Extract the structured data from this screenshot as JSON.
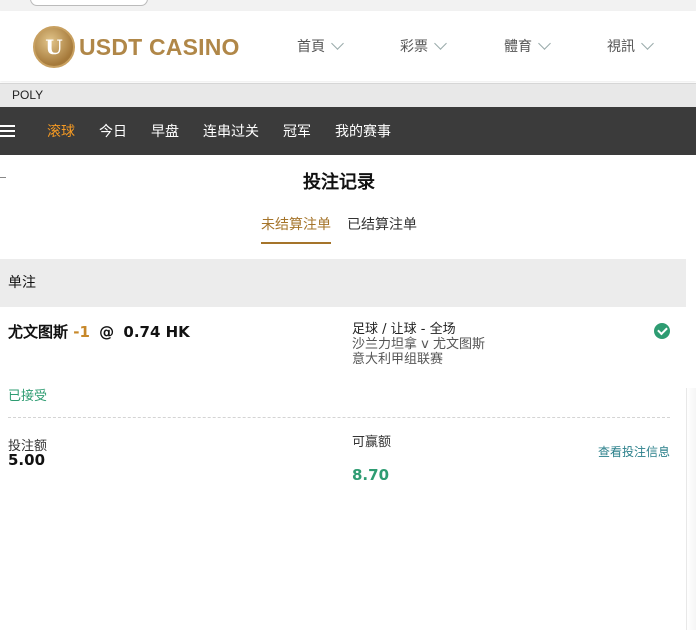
{
  "header": {
    "logo_letter": "U",
    "logo_text": "USDT CASINO",
    "nav": [
      "首頁",
      "彩票",
      "體育",
      "視訊"
    ]
  },
  "provider": "POLY",
  "sport_tabs": [
    "滚球",
    "今日",
    "早盘",
    "连串过关",
    "冠军",
    "我的赛事"
  ],
  "active_tab": "滚球",
  "page_title": "投注记录",
  "subtabs": [
    "未结算注单",
    "已结算注单"
  ],
  "section_label": "单注",
  "bet": {
    "selection": "尤文图斯",
    "handicap": "-1",
    "at": "@",
    "odds": "0.74 HK",
    "market": "足球 / 让球 - 全场",
    "teams": "沙兰力坦拿 v 尤文图斯",
    "league": "意大利甲组联赛",
    "status": "已接受",
    "stake_label": "投注额",
    "stake": "5.00",
    "win_label": "可赢额",
    "win": "8.70",
    "view_link": "查看投注信息"
  },
  "colors": {
    "brand_gold": "#b08748",
    "active_tab": "#f59a23",
    "dark_bar": "#3b3b3b",
    "accepted_green": "#2e9c72",
    "link_teal": "#2a7f8a"
  }
}
